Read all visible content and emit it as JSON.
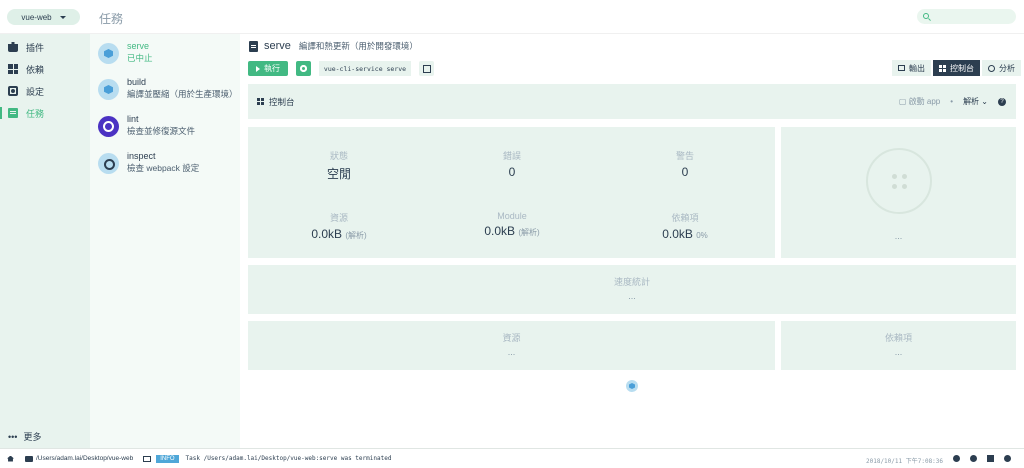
{
  "topbar": {
    "project": "vue-web",
    "title": "任務"
  },
  "nav": {
    "items": [
      {
        "label": "插件",
        "icon": "puzzle-icon"
      },
      {
        "label": "依賴",
        "icon": "dependencies-icon"
      },
      {
        "label": "設定",
        "icon": "settings-icon"
      },
      {
        "label": "任務",
        "icon": "tasks-icon",
        "active": true
      }
    ],
    "more": "更多"
  },
  "tasks": [
    {
      "name": "serve",
      "desc": "已中止",
      "active": true
    },
    {
      "name": "build",
      "desc": "編譯並壓縮（用於生產環境）"
    },
    {
      "name": "lint",
      "desc": "檢查並修復源文件"
    },
    {
      "name": "inspect",
      "desc": "檢查 webpack 設定"
    }
  ],
  "main": {
    "title": "serve",
    "desc": "編譯和熱更新（用於開發環境）",
    "run_label": "執行",
    "command": "vue-cli-service serve",
    "views": {
      "output": "輸出",
      "dashboard": "控制台",
      "analyze": "分析"
    },
    "dashboard": {
      "title": "控制台",
      "start_app": "啟動 app",
      "analyze": "解析"
    },
    "stats": {
      "status_label": "狀態",
      "status_val": "空閒",
      "errors_label": "錯誤",
      "errors_val": "0",
      "warnings_label": "警告",
      "warnings_val": "0",
      "assets_label": "資源",
      "assets_val": "0.0kB",
      "assets_sub": "(解析)",
      "module_label": "Module",
      "module_val": "0.0kB",
      "module_sub": "(解析)",
      "deps_label": "依賴項",
      "deps_val": "0.0kB",
      "deps_sub": "0%"
    },
    "status_ellipsis": "...",
    "speed": {
      "title": "速度統計",
      "val": "..."
    },
    "assets": {
      "title": "資源",
      "val": "..."
    },
    "dependencies": {
      "title": "依賴項",
      "val": "..."
    }
  },
  "statusbar": {
    "path": "/Users/adam.lai/Desktop/vue-web",
    "badge": "INFO",
    "message": "Task /Users/adam.lai/Desktop/vue-web:serve was terminated",
    "time": "2018/10/11 下午7:08:36"
  }
}
